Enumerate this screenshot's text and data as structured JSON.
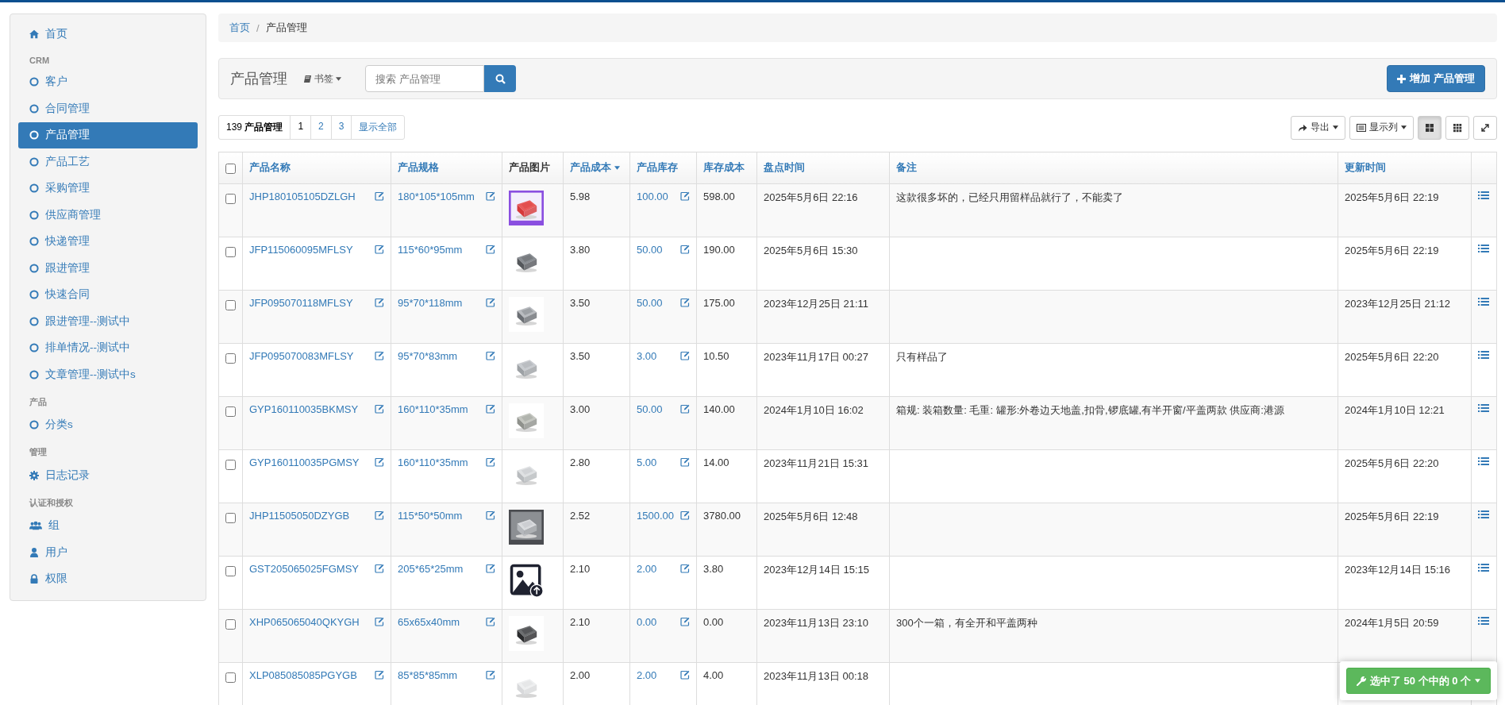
{
  "sidebar": {
    "items": [
      {
        "kind": "home",
        "label": "首页",
        "selected": false
      },
      {
        "kind": "section",
        "label": "CRM"
      },
      {
        "kind": "link",
        "label": "客户",
        "selected": false
      },
      {
        "kind": "link",
        "label": "合同管理",
        "selected": false
      },
      {
        "kind": "link",
        "label": "产品管理",
        "selected": true
      },
      {
        "kind": "link",
        "label": "产品工艺",
        "selected": false
      },
      {
        "kind": "link",
        "label": "采购管理",
        "selected": false
      },
      {
        "kind": "link",
        "label": "供应商管理",
        "selected": false
      },
      {
        "kind": "link",
        "label": "快递管理",
        "selected": false
      },
      {
        "kind": "link",
        "label": "跟进管理",
        "selected": false
      },
      {
        "kind": "link",
        "label": "快速合同",
        "selected": false
      },
      {
        "kind": "link",
        "label": "跟进管理--测试中",
        "selected": false
      },
      {
        "kind": "link",
        "label": "排单情况--测试中",
        "selected": false
      },
      {
        "kind": "link",
        "label": "文章管理--测试中s",
        "selected": false
      },
      {
        "kind": "section",
        "label": "产品"
      },
      {
        "kind": "link",
        "label": "分类s",
        "selected": false
      },
      {
        "kind": "section",
        "label": "管理"
      },
      {
        "kind": "settings",
        "label": "日志记录",
        "selected": false
      },
      {
        "kind": "section",
        "label": "认证和授权"
      },
      {
        "kind": "group",
        "label": "组",
        "selected": false
      },
      {
        "kind": "user",
        "label": "用户",
        "selected": false
      },
      {
        "kind": "lock",
        "label": "权限",
        "selected": false
      }
    ]
  },
  "breadcrumb": {
    "items": [
      "首页",
      "产品管理"
    ],
    "separator": "/"
  },
  "toolbar": {
    "title": "产品管理",
    "bookmarks": "书签",
    "search": {
      "placeholder": "搜索 产品管理"
    },
    "add_button": "增加 产品管理"
  },
  "pagination": {
    "count": "139",
    "count_label": "产品管理",
    "pages": [
      {
        "label": "1",
        "selected": true
      },
      {
        "label": "2",
        "selected": false
      },
      {
        "label": "3",
        "selected": false
      },
      {
        "label": "显示全部",
        "selected": false
      }
    ]
  },
  "actions": {
    "export": "导出",
    "columns": "显示列",
    "views": [
      {
        "kind": "cards",
        "selected": true
      },
      {
        "kind": "grid",
        "selected": false
      }
    ]
  },
  "table": {
    "select_all_checked": false,
    "columns": [
      {
        "label": "产品名称",
        "sortable": true,
        "sorted": false
      },
      {
        "label": "产品规格",
        "sortable": true,
        "sorted": false
      },
      {
        "label": "产品图片",
        "sortable": false,
        "sorted": false
      },
      {
        "label": "产品成本",
        "sortable": true,
        "sorted": true
      },
      {
        "label": "产品库存",
        "sortable": true,
        "sorted": false
      },
      {
        "label": "库存成本",
        "sortable": true,
        "sorted": false
      },
      {
        "label": "盘点时间",
        "sortable": true,
        "sorted": false
      },
      {
        "label": "备注",
        "sortable": true,
        "sorted": false
      },
      {
        "label": "更新时间",
        "sortable": true,
        "sorted": false
      }
    ],
    "rows": [
      {
        "name": "JHP180105105DZLGH",
        "spec": "180*105*105mm",
        "cost": "5.98",
        "stock": "100.00",
        "stock_cost": "598.00",
        "check_time": "2025年5月6日 22:16",
        "note": "这款很多坏的，已经只用留样品就行了，不能卖了",
        "updated": "2025年5月6日 22:19",
        "checked": false
      },
      {
        "name": "JFP115060095MFLSY",
        "spec": "115*60*95mm",
        "cost": "3.80",
        "stock": "50.00",
        "stock_cost": "190.00",
        "check_time": "2025年5月6日 15:30",
        "updated": "2025年5月6日 22:19",
        "checked": false
      },
      {
        "name": "JFP095070118MFLSY",
        "spec": "95*70*118mm",
        "cost": "3.50",
        "stock": "50.00",
        "stock_cost": "175.00",
        "check_time": "2023年12月25日 21:11",
        "updated": "2023年12月25日 21:12",
        "checked": false
      },
      {
        "name": "JFP095070083MFLSY",
        "spec": "95*70*83mm",
        "cost": "3.50",
        "stock": "3.00",
        "stock_cost": "10.50",
        "check_time": "2023年11月17日 00:27",
        "note": "只有样品了",
        "updated": "2025年5月6日 22:20",
        "checked": false
      },
      {
        "name": "GYP160110035BKMSY",
        "spec": "160*110*35mm",
        "cost": "3.00",
        "stock": "50.00",
        "stock_cost": "140.00",
        "check_time": "2024年1月10日 16:02",
        "note": "箱规: 装箱数量: 毛重: 罐形:外卷边天地盖,扣骨,锣底罐,有半开窗/平盖两款 供应商:港源",
        "updated": "2024年1月10日 12:21",
        "checked": false
      },
      {
        "name": "GYP160110035PGMSY",
        "spec": "160*110*35mm",
        "cost": "2.80",
        "stock": "5.00",
        "stock_cost": "14.00",
        "check_time": "2023年11月21日 15:31",
        "updated": "2025年5月6日 22:20",
        "checked": false
      },
      {
        "name": "JHP11505050DZYGB",
        "spec": "115*50*50mm",
        "cost": "2.52",
        "stock": "1500.00",
        "stock_cost": "3780.00",
        "check_time": "2025年5月6日 12:48",
        "updated": "2025年5月6日 22:19",
        "checked": false
      },
      {
        "name": "GST205065025FGMSY",
        "spec": "205*65*25mm",
        "image": {
          "kind": "placeholder"
        },
        "cost": "2.10",
        "stock": "2.00",
        "stock_cost": "3.80",
        "check_time": "2023年12月14日 15:15",
        "updated": "2023年12月14日 15:16",
        "checked": false
      },
      {
        "name": "XHP065065040QKYGH",
        "spec": "65x65x40mm",
        "cost": "2.10",
        "stock": "0.00",
        "stock_cost": "0.00",
        "check_time": "2023年11月13日 23:10",
        "note": "300个一箱，有全开和平盖两种",
        "updated": "2024年1月5日 20:59",
        "checked": false
      },
      {
        "name": "XLP085085085PGYGB",
        "spec": "85*85*85mm",
        "cost": "2.00",
        "stock": "2.00",
        "stock_cost": "4.00",
        "check_time": "2023年11月13日 00:18",
        "checked": false
      }
    ]
  },
  "selection_button": "选中了 50 个中的 0 个"
}
